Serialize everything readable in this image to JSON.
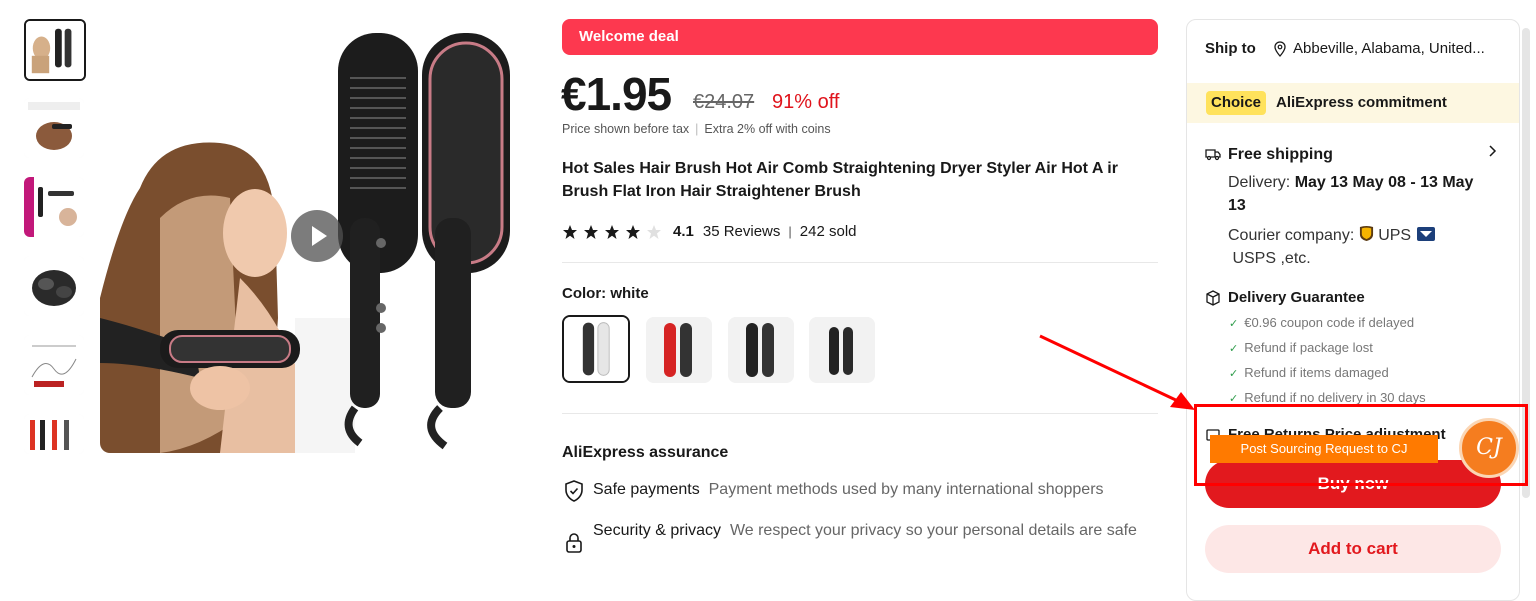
{
  "banner": {
    "label": "Welcome deal"
  },
  "price": {
    "current": "€1.95",
    "original": "€24.07",
    "discount": "91% off",
    "tax_note": "Price shown before tax",
    "coins_note": "Extra 2% off with coins"
  },
  "product": {
    "title": "Hot Sales Hair Brush Hot Air Comb Straightening Dryer Styler Air Hot A ir Brush Flat Iron Hair Straightener Brush"
  },
  "rating": {
    "value": "4.1",
    "stars": 4,
    "reviews": "35 Reviews",
    "sold": "242 sold",
    "separator": "|"
  },
  "color": {
    "label": "Color: white",
    "options": [
      "white",
      "red",
      "black",
      "black small"
    ]
  },
  "assurance": {
    "title": "AliExpress assurance",
    "items": [
      {
        "name": "Safe payments",
        "desc": "Payment methods used by many international shoppers"
      },
      {
        "name": "Security & privacy",
        "desc": "We respect your privacy so your personal details are safe"
      }
    ]
  },
  "shipping": {
    "ship_to_label": "Ship to",
    "location": "Abbeville, Alabama, United...",
    "choice_badge": "Choice",
    "commitment": "AliExpress commitment",
    "free_shipping": "Free shipping",
    "delivery_label": "Delivery:",
    "delivery_dates": "May 13 May 08 - 13 May 13",
    "courier_label": "Courier company:",
    "courier_ups": "UPS",
    "courier_usps": "USPS ,etc.",
    "guarantee_title": "Delivery Guarantee",
    "guarantee_items": [
      "€0.96 coupon code if delayed",
      "Refund if package lost",
      "Refund if items damaged",
      "Refund if no delivery in 30 days"
    ],
    "returns_title": "Free Returns Price adjustment"
  },
  "actions": {
    "buy_now": "Buy now",
    "add_to_cart": "Add to cart"
  },
  "overlay": {
    "sourcing_button": "Post Sourcing Request to CJ",
    "logo_text": "CJ"
  },
  "colors": {
    "accent": "#fd384f",
    "buy": "#e2191e",
    "discount": "#e0141c",
    "choice": "#ffe25c",
    "highlight": "#ff0000",
    "sourcing": "#ff7a00"
  }
}
